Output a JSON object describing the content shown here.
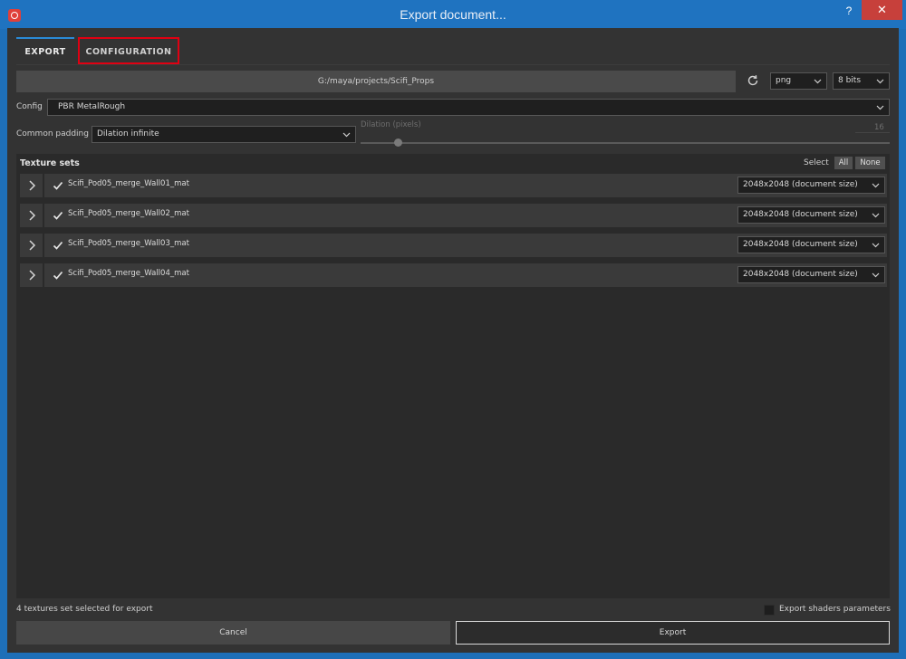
{
  "window": {
    "title": "Export document...",
    "help_label": "?",
    "close_label": "✕"
  },
  "tabs": [
    {
      "label": "EXPORT",
      "active": true
    },
    {
      "label": "CONFIGURATION",
      "active": false
    }
  ],
  "export": {
    "path": "G:/maya/projects/Scifi_Props",
    "format": "png",
    "bit_depth": "8 bits",
    "config_label": "Config",
    "config_value": "PBR MetalRough",
    "padding_label": "Common padding",
    "padding_value": "Dilation infinite",
    "dilation_label": "Dilation (pixels)",
    "dilation_value": "16"
  },
  "texture_sets": {
    "title": "Texture sets",
    "select_label": "Select",
    "all_label": "All",
    "none_label": "None",
    "items": [
      {
        "name": "Scifi_Pod05_merge_Wall01_mat",
        "checked": true,
        "size": "2048x2048 (document size)"
      },
      {
        "name": "Scifi_Pod05_merge_Wall02_mat",
        "checked": true,
        "size": "2048x2048 (document size)"
      },
      {
        "name": "Scifi_Pod05_merge_Wall03_mat",
        "checked": true,
        "size": "2048x2048 (document size)"
      },
      {
        "name": "Scifi_Pod05_merge_Wall04_mat",
        "checked": true,
        "size": "2048x2048 (document size)"
      }
    ]
  },
  "footer": {
    "status": "4 textures set selected for export",
    "shader_params_label": "Export shaders parameters",
    "cancel_label": "Cancel",
    "export_label": "Export"
  },
  "colors": {
    "titlebar": "#1f73c0",
    "accent": "#2a8ad6",
    "highlight_box": "#e00012",
    "close_button": "#c7403b"
  }
}
